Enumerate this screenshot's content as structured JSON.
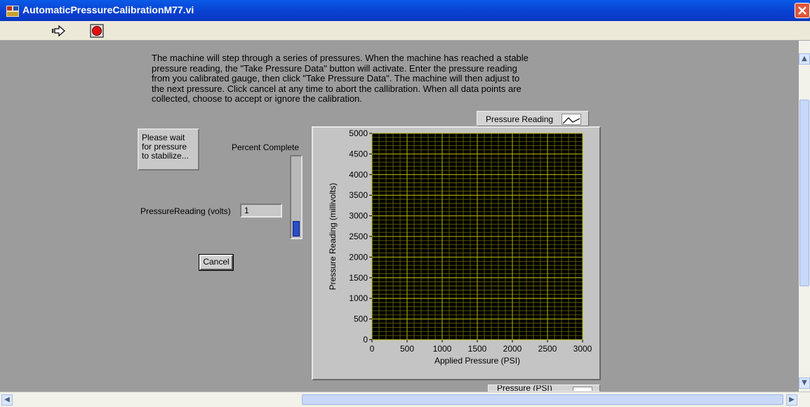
{
  "window": {
    "title": "AutomaticPressureCalibrationM77.vi"
  },
  "toolbar": {
    "run_icon": "run-arrow-icon",
    "stop_icon": "abort-stop-icon"
  },
  "instructions": "The machine will step through a series of pressures.  When the machine has reached a stable\npressure reading, the \"Take Pressure Data\" button will activate.  Enter the pressure reading\nfrom you calibrated gauge, then click \"Take Pressure Data\".  The machine will then adjust to\nthe next pressure.  Click cancel at any time to abort the callibration.  When all data points are\ncollected, choose to accept or ignore the calibration.",
  "status": {
    "message": "Please wait for pressure to stabilize..."
  },
  "progress": {
    "label": "Percent Complete",
    "value_fraction": 0.2
  },
  "pressure_reading": {
    "label": "PressureReading (volts)",
    "value": "1"
  },
  "cancel_label": "Cancel",
  "legend": {
    "series1": "Pressure Reading",
    "series2": "Pressure (PSI)"
  },
  "chart_data": {
    "type": "scatter",
    "xlabel": "Applied Pressure (PSI)",
    "ylabel": "Pressure Reading (millivolts)",
    "xlim": [
      0,
      3000
    ],
    "ylim": [
      0,
      5000
    ],
    "x_ticks": [
      "0",
      "500",
      "1000",
      "1500",
      "2000",
      "2500",
      "3000"
    ],
    "y_ticks": [
      "0",
      "500",
      "1000",
      "1500",
      "2000",
      "2500",
      "3000",
      "3500",
      "4000",
      "4500",
      "5000"
    ],
    "grid": true,
    "series": [],
    "colors": {
      "plot_bg": "#000000",
      "major_grid": "#b8b800",
      "minor_grid": "#6e6e00"
    }
  }
}
